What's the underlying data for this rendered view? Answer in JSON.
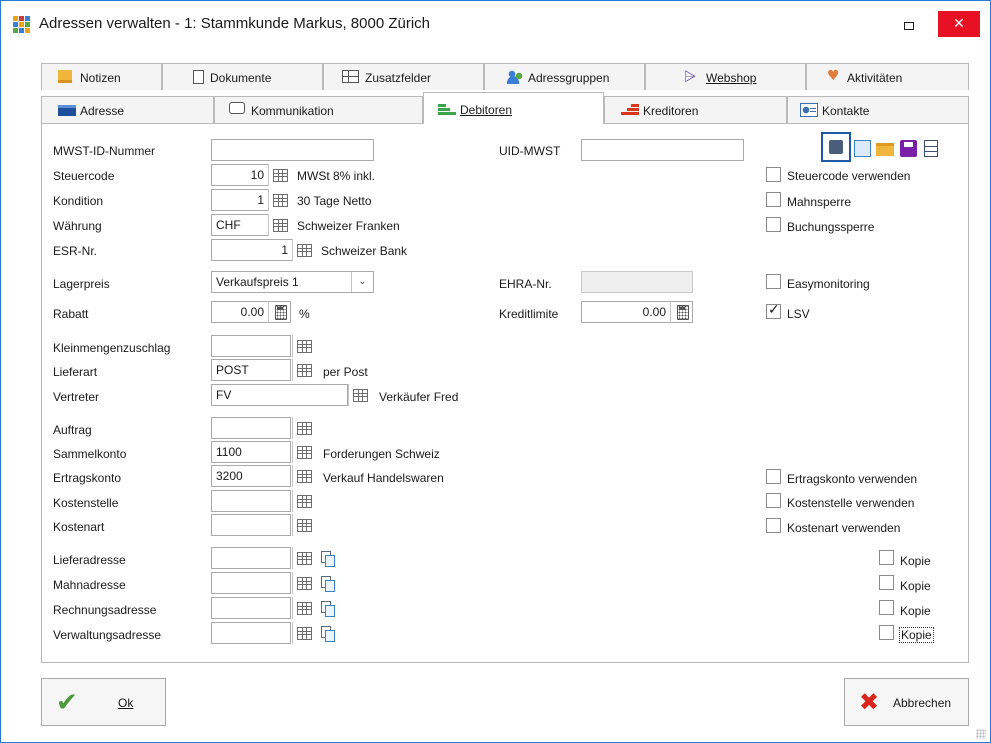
{
  "window": {
    "title": "Adressen verwalten - 1: Stammkunde Markus, 8000 Zürich",
    "close_glyph": "✕"
  },
  "tabs_row1": [
    {
      "label": "Notizen",
      "icon": "note-icon"
    },
    {
      "label": "Dokumente",
      "icon": "document-icon"
    },
    {
      "label": "Zusatzfelder",
      "icon": "fields-icon"
    },
    {
      "label": "Adressgruppen",
      "icon": "group-icon"
    },
    {
      "label": "Webshop",
      "icon": "cart-icon"
    },
    {
      "label": "Aktivitäten",
      "icon": "heart-icon"
    }
  ],
  "tabs_row2": [
    {
      "label": "Adresse",
      "icon": "address-icon"
    },
    {
      "label": "Kommunikation",
      "icon": "chat-icon"
    },
    {
      "label": "Debitoren",
      "icon": "debitor-icon",
      "active": true
    },
    {
      "label": "Kreditoren",
      "icon": "creditor-icon"
    },
    {
      "label": "Kontakte",
      "icon": "contact-card-icon"
    }
  ],
  "form": {
    "mwst_id": {
      "label": "MWST-ID-Nummer",
      "value": ""
    },
    "uid_mwst": {
      "label": "UID-MWST",
      "value": ""
    },
    "steuercode": {
      "label": "Steuercode",
      "value": "10",
      "desc": "MWSt 8% inkl."
    },
    "kondition": {
      "label": "Kondition",
      "value": "1",
      "desc": "30 Tage Netto"
    },
    "waehrung": {
      "label": "Währung",
      "value": "CHF",
      "desc": "Schweizer Franken"
    },
    "esr": {
      "label": "ESR-Nr.",
      "value": "1",
      "desc": "Schweizer Bank"
    },
    "lagerpreis": {
      "label": "Lagerpreis",
      "value": "Verkaufspreis 1"
    },
    "ehra": {
      "label": "EHRA-Nr.",
      "value": ""
    },
    "rabatt": {
      "label": "Rabatt",
      "value": "0.00",
      "unit": "%"
    },
    "kreditlimite": {
      "label": "Kreditlimite",
      "value": "0.00"
    },
    "kleinmengen": {
      "label": "Kleinmengenzuschlag",
      "value": ""
    },
    "lieferart": {
      "label": "Lieferart",
      "value": "POST",
      "desc": "per Post"
    },
    "vertreter": {
      "label": "Vertreter",
      "value": "FV",
      "desc": "Verkäufer Fred"
    },
    "auftrag": {
      "label": "Auftrag",
      "value": ""
    },
    "sammelkonto": {
      "label": "Sammelkonto",
      "value": "1100",
      "desc": "Forderungen Schweiz"
    },
    "ertragskonto": {
      "label": "Ertragskonto",
      "value": "3200",
      "desc": "Verkauf Handelswaren"
    },
    "kostenstelle": {
      "label": "Kostenstelle",
      "value": ""
    },
    "kostenart": {
      "label": "Kostenart",
      "value": ""
    },
    "lieferadresse": {
      "label": "Lieferadresse",
      "value": ""
    },
    "mahnadresse": {
      "label": "Mahnadresse",
      "value": ""
    },
    "rechnungsadresse": {
      "label": "Rechnungsadresse",
      "value": ""
    },
    "verwaltungsadresse": {
      "label": "Verwaltungsadresse",
      "value": ""
    }
  },
  "checkboxes": {
    "steuercode_verwenden": {
      "label": "Steuercode verwenden",
      "checked": false
    },
    "mahnsperre": {
      "label": "Mahnsperre",
      "checked": false
    },
    "buchungssperre": {
      "label": "Buchungssperre",
      "checked": false
    },
    "easymonitoring": {
      "label": "Easymonitoring",
      "checked": false
    },
    "lsv": {
      "label": "LSV",
      "checked": true
    },
    "ertragskonto_verwenden": {
      "label": "Ertragskonto verwenden",
      "checked": false
    },
    "kostenstelle_verwenden": {
      "label": "Kostenstelle verwenden",
      "checked": false
    },
    "kostenart_verwenden": {
      "label": "Kostenart verwenden",
      "checked": false
    },
    "kopie": {
      "label": "Kopie"
    }
  },
  "toolbar_icons": [
    "settings-list-icon",
    "transfer-icon",
    "folder-icon",
    "save-icon",
    "table-export-icon"
  ],
  "buttons": {
    "ok": "Ok",
    "cancel": "Abbrechen"
  },
  "colors": {
    "accent": "#2b79d6",
    "close": "#e81123",
    "ok_check": "#4c9a3c",
    "cancel_x": "#d9261c"
  }
}
